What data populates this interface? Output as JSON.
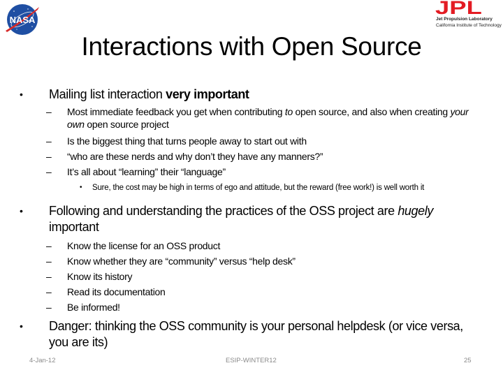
{
  "header": {
    "title": "Interactions with Open Source",
    "left_logo": "nasa-logo",
    "left_logo_text": "NASA",
    "right_logo": "jpl-logo",
    "right_logo_mark": "JPL",
    "right_logo_line1": "Jet Propulsion Laboratory",
    "right_logo_line2": "California Institute of Technology",
    "brand_colors": {
      "nasa_blue": "#1f4fa3",
      "nasa_red": "#d62b2b",
      "jpl_red": "#e31b23"
    }
  },
  "bullets": [
    {
      "text_parts": [
        {
          "text": "Mailing list interaction ",
          "style": "normal"
        },
        {
          "text": "very important",
          "style": "bold"
        }
      ],
      "sub": [
        {
          "parts": [
            {
              "text": "Most immediate feedback you get when contributing ",
              "style": "normal"
            },
            {
              "text": "to",
              "style": "italic"
            },
            {
              "text": " open source, and also when creating ",
              "style": "normal"
            },
            {
              "text": "your own",
              "style": "italic"
            },
            {
              "text": " open source project",
              "style": "normal"
            }
          ]
        },
        {
          "text": "Is the biggest thing that turns people away to start out with"
        },
        {
          "text": "“who are these nerds and why don’t they have any manners?”"
        },
        {
          "text": "It’s all about “learning” their “language”",
          "sub": [
            {
              "text": "Sure, the cost may be high in terms of ego and attitude, but the reward (free work!) is well worth it"
            }
          ]
        }
      ]
    },
    {
      "text_parts": [
        {
          "text": "Following and understanding the practices of the OSS project are ",
          "style": "normal"
        },
        {
          "text": "hugely",
          "style": "italic"
        },
        {
          "text": " important",
          "style": "normal"
        }
      ],
      "sub": [
        {
          "text": "Know the license for an OSS product"
        },
        {
          "text": "Know whether they are “community” versus “help desk”"
        },
        {
          "text": "Know its history"
        },
        {
          "text": "Read its documentation"
        },
        {
          "text": "Be informed!"
        }
      ]
    },
    {
      "text_parts": [
        {
          "text": "Danger: thinking the OSS community is your personal helpdesk (or vice versa, you are its)",
          "style": "normal"
        }
      ]
    }
  ],
  "bullet_glyph": "•",
  "dash_glyph": "–",
  "footer": {
    "date": "4-Jan-12",
    "center": "ESIP-WINTER12",
    "page": "25"
  }
}
